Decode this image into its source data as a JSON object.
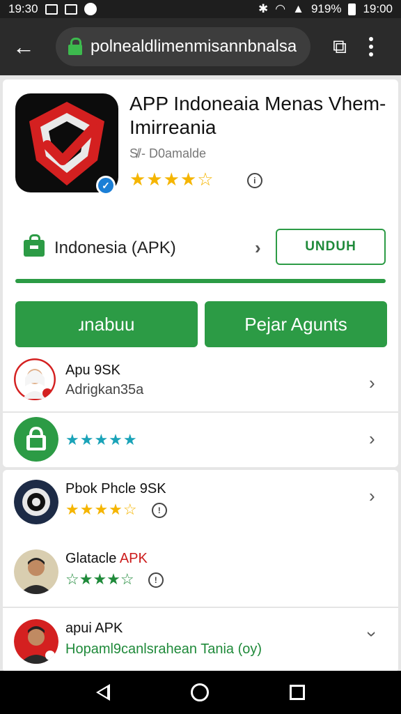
{
  "statusbar": {
    "time_left": "19:30",
    "battery": "919%",
    "time_right": "19:00"
  },
  "browser": {
    "url": "polnealdlimenmisannbnalsa"
  },
  "app": {
    "title": "APP Indoneaia Menas Vhem- Imirreania",
    "subtitle": "S̸/- D0amalde",
    "stars": "★★★★☆"
  },
  "download": {
    "label": "Indonesia (APK)",
    "button": "UNDUH"
  },
  "actions": {
    "primary": "ɹnabuu",
    "secondary": "Pejar Agunts"
  },
  "list1": [
    {
      "name": "Apu 9SK",
      "sub": "Adrigkan35a"
    },
    {
      "stars": "★★★★★"
    }
  ],
  "list2": [
    {
      "name": "Pbok Phcle 9SK",
      "stars": "★★★★☆"
    },
    {
      "name_prefix": "Glatacle ",
      "name_suffix": "APK",
      "stars": "☆★★★☆"
    },
    {
      "name": "apui APK",
      "sub": "Hopaml9canlsrahean Tania (oy)"
    }
  ],
  "colors": {
    "accent": "#2c9b45",
    "star": "#f5b500",
    "teal_star": "#1aa3b8",
    "dark": "#2b2b2b"
  }
}
